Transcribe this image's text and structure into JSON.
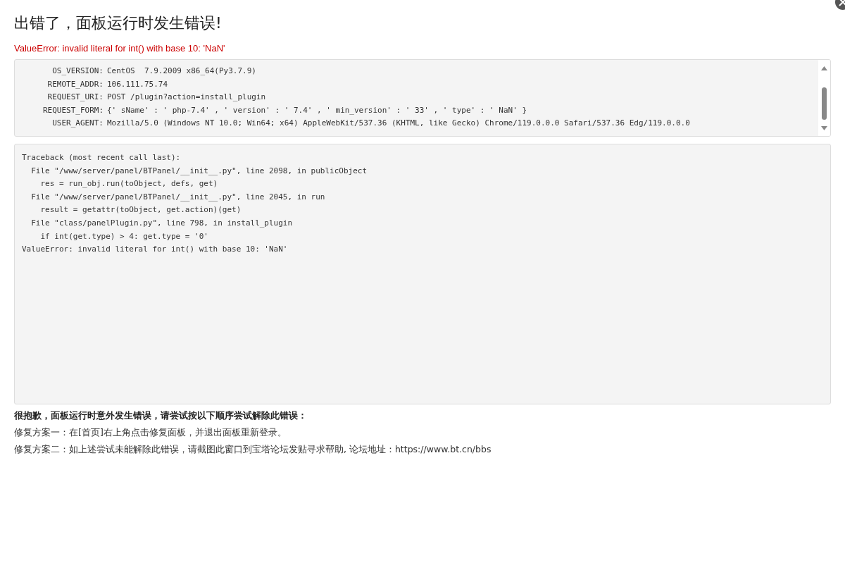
{
  "title": "出错了，面板运行时发生错误!",
  "error": "ValueError: invalid literal for int() with base 10: 'NaN'",
  "info": [
    {
      "key": "OS_VERSION:",
      "value": "CentOS  7.9.2009 x86_64(Py3.7.9)"
    },
    {
      "key": "REMOTE_ADDR:",
      "value": "106.111.75.74"
    },
    {
      "key": "REQUEST_URI:",
      "value": "POST /plugin?action=install_plugin"
    },
    {
      "key": "REQUEST_FORM:",
      "value": "{' sName' : ' php-7.4' , ' version' : ' 7.4' , ' min_version' : ' 33' , ' type' : ' NaN' }"
    },
    {
      "key": "USER_AGENT:",
      "value": "Mozilla/5.0 (Windows NT 10.0; Win64; x64) AppleWebKit/537.36 (KHTML, like Gecko) Chrome/119.0.0.0 Safari/537.36 Edg/119.0.0.0"
    }
  ],
  "traceback": [
    "Traceback (most recent call last):",
    "  File \"/www/server/panel/BTPanel/__init__.py\", line 2098, in publicObject",
    "    res = run_obj.run(toObject, defs, get)",
    "  File \"/www/server/panel/BTPanel/__init__.py\", line 2045, in run",
    "    result = getattr(toObject, get.action)(get)",
    "  File \"class/panelPlugin.py\", line 798, in install_plugin",
    "    if int(get.type) > 4: get.type = '0'",
    "ValueError: invalid literal for int() with base 10: 'NaN'"
  ],
  "help_title": "很抱歉，面板运行时意外发生错误，请尝试按以下顺序尝试解除此错误：",
  "help": [
    "修复方案一：在[首页]右上角点击修复面板，并退出面板重新登录。",
    "修复方案二：如上述尝试未能解除此错误，请截图此窗口到宝塔论坛发贴寻求帮助, 论坛地址：https://www.bt.cn/bbs"
  ]
}
